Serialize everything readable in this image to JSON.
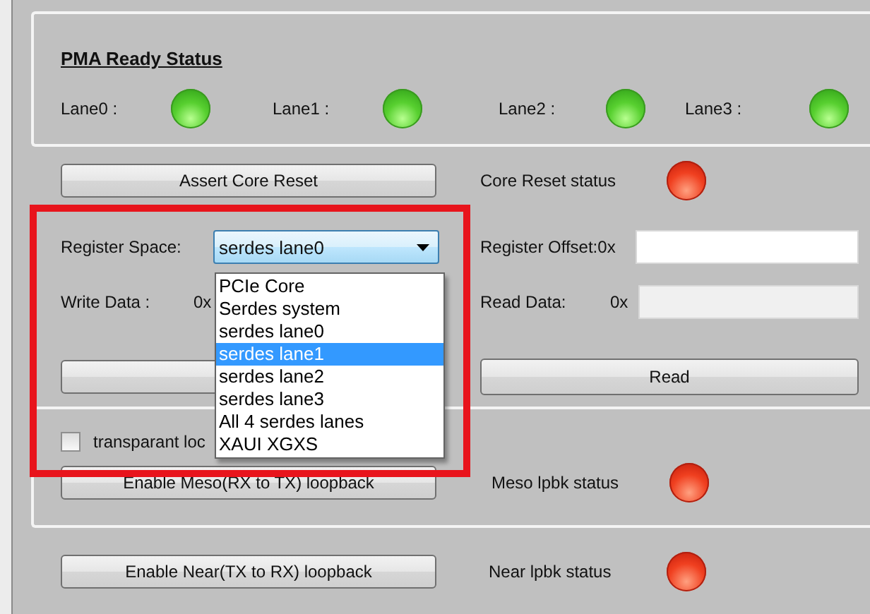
{
  "pma_status": {
    "title": "PMA Ready Status",
    "lanes": [
      {
        "label": "Lane0 :",
        "on": true
      },
      {
        "label": "Lane1 :",
        "on": true
      },
      {
        "label": "Lane2 :",
        "on": true
      },
      {
        "label": "Lane3 :",
        "on": true
      }
    ]
  },
  "reset": {
    "button": "Assert Core Reset",
    "status_label": "Core Reset status",
    "on": false
  },
  "register": {
    "space_label": "Register Space:",
    "space_value": "serdes lane0",
    "offset_label": "Register Offset:0x",
    "write_label": "Write Data :",
    "write_prefix": "0x",
    "read_label": "Read Data:",
    "read_prefix": "0x",
    "read_button": "Read",
    "dropdown_options": [
      {
        "label": "PCIe Core",
        "selected": false
      },
      {
        "label": "Serdes system",
        "selected": false
      },
      {
        "label": "serdes lane0",
        "selected": false
      },
      {
        "label": "serdes lane1",
        "selected": true
      },
      {
        "label": "serdes lane2",
        "selected": false
      },
      {
        "label": "serdes lane3",
        "selected": false
      },
      {
        "label": "All 4 serdes lanes",
        "selected": false
      },
      {
        "label": "XAUI XGXS",
        "selected": false
      }
    ]
  },
  "transparent_checkbox": {
    "label": "transparant loc",
    "checked": false
  },
  "loopbacks": [
    {
      "button": "Enable Meso(RX to TX) loopback",
      "status_label": "Meso lpbk status",
      "on": false
    },
    {
      "button": "Enable Near(TX to RX) loopback",
      "status_label": "Near lpbk status",
      "on": false
    }
  ]
}
